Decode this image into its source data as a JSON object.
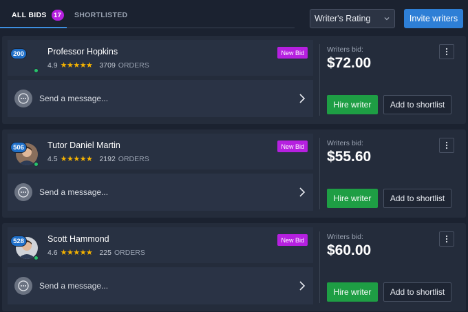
{
  "tabs": {
    "all_bids": {
      "label": "ALL BIDS",
      "count": "17"
    },
    "shortlisted": {
      "label": "SHORTLISTED"
    }
  },
  "sort": {
    "selected": "Writer's Rating"
  },
  "invite_label": "Invite writers",
  "colors": {
    "accent": "#2e7fd6",
    "badge_purple": "#b620e0",
    "hire_green": "#1e9e44",
    "star": "#f5b301",
    "level_blue": "#1f6fc8"
  },
  "bids": [
    {
      "level": "200",
      "name": "Professor Hopkins",
      "rating": "4.9",
      "stars": "★★★★★",
      "orders": "3709",
      "orders_label": "ORDERS",
      "badge": "New Bid",
      "message_placeholder": "Send a message...",
      "bid_label": "Writers bid:",
      "amount": "$72.00",
      "hire_label": "Hire writer",
      "shortlist_label": "Add to shortlist",
      "avatar": "none"
    },
    {
      "level": "506",
      "name": "Tutor Daniel Martin",
      "rating": "4.5",
      "stars": "★★★★★",
      "orders": "2192",
      "orders_label": "ORDERS",
      "badge": "New Bid",
      "message_placeholder": "Send a message...",
      "bid_label": "Writers bid:",
      "amount": "$55.60",
      "hire_label": "Hire writer",
      "shortlist_label": "Add to shortlist",
      "avatar": "photo"
    },
    {
      "level": "528",
      "name": "Scott Hammond",
      "rating": "4.6",
      "stars": "★★★★★",
      "orders": "225",
      "orders_label": "ORDERS",
      "badge": "New Bid",
      "message_placeholder": "Send a message...",
      "bid_label": "Writers bid:",
      "amount": "$60.00",
      "hire_label": "Hire writer",
      "shortlist_label": "Add to shortlist",
      "avatar": "photo2"
    }
  ]
}
